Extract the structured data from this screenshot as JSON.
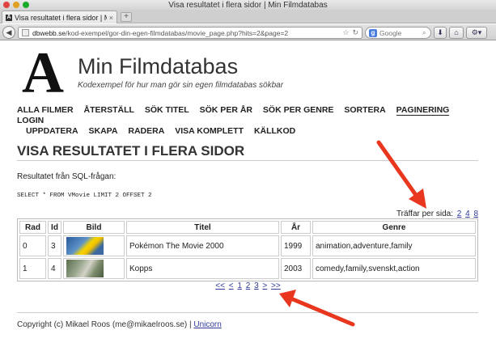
{
  "window": {
    "title": "Visa resultatet i flera sidor | Min Filmdatabas"
  },
  "tab": {
    "label": "Visa resultatet i flera sidor | Mi...",
    "close": "×",
    "favicon": "A",
    "new_tab": "+"
  },
  "nav": {
    "back_icon": "◀",
    "url_domain": "dbwebb.se",
    "url_path": "/kod-exempel/gor-din-egen-filmdatabas/movie_page.php?hits=2&page=2",
    "search_engine": "g",
    "search_placeholder": "Google",
    "toolbar_icons": [
      "download-icon",
      "home-icon",
      "tools-icon"
    ]
  },
  "site": {
    "logo": "A",
    "title": "Min Filmdatabas",
    "slogan": "Kodexempel för hur man gör sin egen filmdatabas sökbar"
  },
  "menu": {
    "row1": [
      "ALLA FILMER",
      "ÅTERSTÄLL",
      "SÖK TITEL",
      "SÖK PER ÅR",
      "SÖK PER GENRE",
      "SORTERA",
      "PAGINERING",
      "LOGIN"
    ],
    "row2": [
      "UPPDATERA",
      "SKAPA",
      "RADERA",
      "VISA KOMPLETT",
      "KÄLLKOD"
    ],
    "active": "PAGINERING"
  },
  "page": {
    "heading": "VISA RESULTATET I FLERA SIDOR",
    "sql_label": "Resultatet från SQL-frågan:",
    "sql": "SELECT * FROM VMovie LIMIT 2 OFFSET 2",
    "hits_label": "Träffar per sida:",
    "hits_options": [
      "2",
      "4",
      "8"
    ]
  },
  "table": {
    "headers": [
      "Rad",
      "Id",
      "Bild",
      "Titel",
      "År",
      "Genre"
    ],
    "rows": [
      {
        "rad": "0",
        "id": "3",
        "title": "Pokémon The Movie 2000",
        "year": "1999",
        "genre": "animation,adventure,family"
      },
      {
        "rad": "1",
        "id": "4",
        "title": "Kopps",
        "year": "2003",
        "genre": "comedy,family,svenskt,action"
      }
    ]
  },
  "pager": {
    "first": "<<",
    "prev": "<",
    "pages": [
      "1",
      "2",
      "3"
    ],
    "next": ">",
    "last": ">>"
  },
  "footer": {
    "text": "Copyright (c) Mikael Roos (me@mikaelroos.se) | ",
    "link": "Unicorn"
  },
  "colors": {
    "link": "#2f3a9a",
    "annotation_arrow": "#e8361f"
  }
}
